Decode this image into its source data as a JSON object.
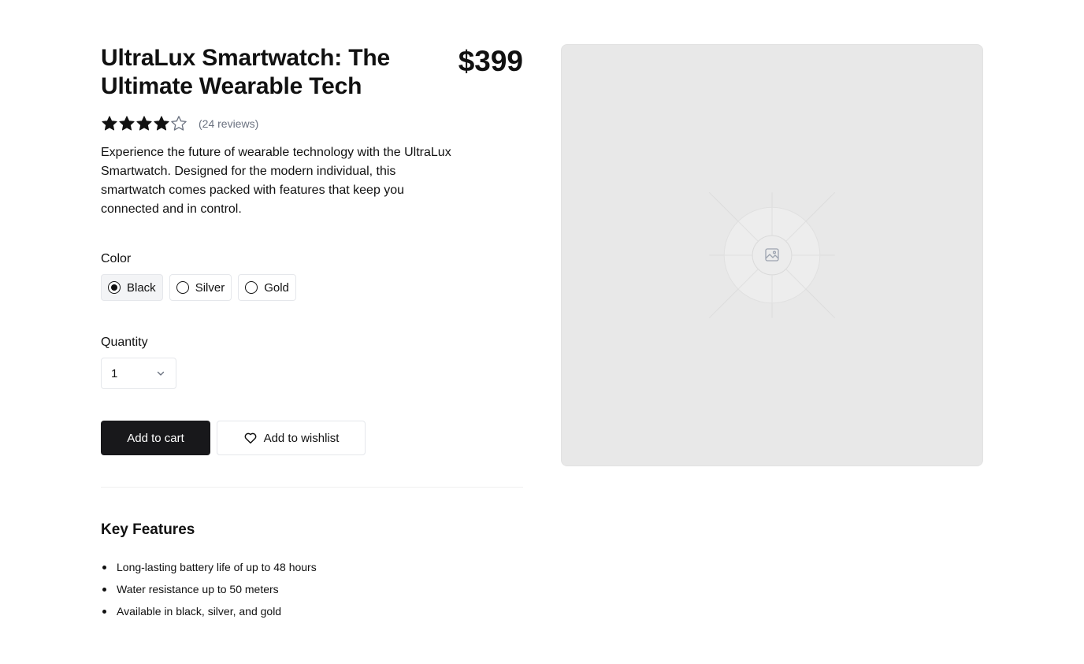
{
  "product": {
    "title": "UltraLux Smartwatch: The Ultimate Wearable Tech",
    "price": "$399",
    "rating": 4,
    "rating_max": 5,
    "reviews_text": "(24 reviews)",
    "description": "Experience the future of wearable technology with the UltraLux Smartwatch. Designed for the modern individual, this smartwatch comes packed with features that keep you connected and in control."
  },
  "color": {
    "label": "Color",
    "options": [
      {
        "label": "Black",
        "selected": true
      },
      {
        "label": "Silver",
        "selected": false
      },
      {
        "label": "Gold",
        "selected": false
      }
    ]
  },
  "quantity": {
    "label": "Quantity",
    "value": "1"
  },
  "actions": {
    "add_to_cart": "Add to cart",
    "add_to_wishlist": "Add to wishlist"
  },
  "features": {
    "title": "Key Features",
    "items": [
      "Long-lasting battery life of up to 48 hours",
      "Water resistance up to 50 meters",
      "Available in black, silver, and gold"
    ]
  },
  "colors": {
    "primary_button": "#18181b",
    "image_bg": "#e8e8e8",
    "muted_text": "#6b7280"
  },
  "icons": {
    "star": "star-icon",
    "heart": "heart-icon",
    "chevron": "chevron-down-icon",
    "image": "image-placeholder-icon"
  }
}
